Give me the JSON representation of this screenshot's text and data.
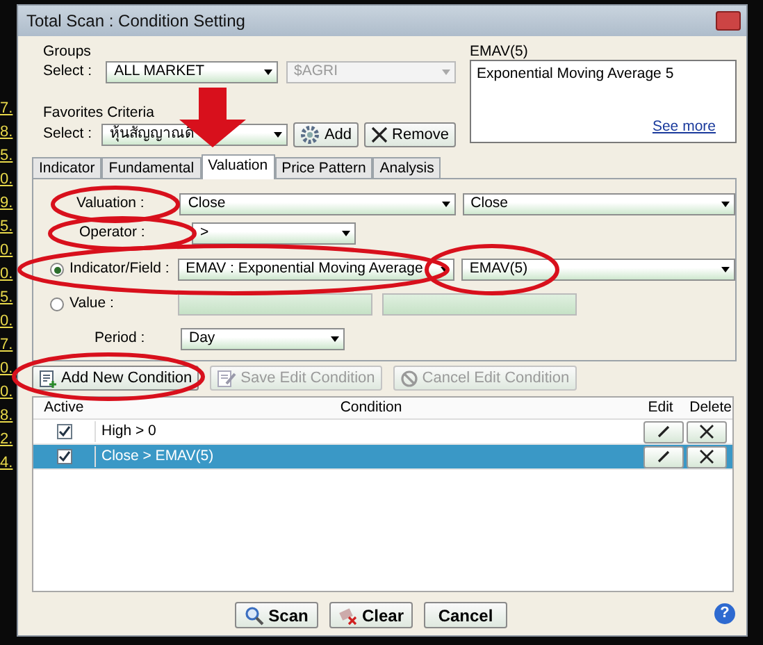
{
  "window": {
    "title": "Total Scan : Condition Setting"
  },
  "background_text": [
    "7.",
    "8.",
    "5.",
    "0.",
    "9.",
    "5.",
    "0.",
    "0.",
    "5.",
    "0.",
    "7.",
    "0.",
    "0.",
    "8.",
    "2.",
    "4."
  ],
  "groups": {
    "heading": "Groups",
    "select_label": "Select :",
    "market": "ALL MARKET",
    "group": "$AGRI",
    "group_disabled": true
  },
  "favorites": {
    "heading": "Favorites Criteria",
    "select_label": "Select :",
    "value": "หุ้นสัญญาณดี",
    "add_button": "Add",
    "remove_button": "Remove"
  },
  "description": {
    "title": "EMAV(5)",
    "text": "Exponential Moving Average 5",
    "link": "See more"
  },
  "tabs": [
    {
      "label": "Indicator",
      "selected": false
    },
    {
      "label": "Fundamental",
      "selected": false
    },
    {
      "label": "Valuation",
      "selected": true
    },
    {
      "label": "Price Pattern",
      "selected": false
    },
    {
      "label": "Analysis",
      "selected": false
    }
  ],
  "form": {
    "valuation_label": "Valuation :",
    "valuation": [
      "Close",
      "Close"
    ],
    "operator_label": "Operator :",
    "operator": ">",
    "sources": [
      {
        "label": "Indicator/Field :",
        "selected": true,
        "kind": "combo",
        "values": [
          "EMAV : Exponential Moving Average",
          "EMAV(5)"
        ]
      },
      {
        "label": "Value :",
        "selected": false,
        "kind": "text"
      }
    ],
    "period_label": "Period :",
    "period": "Day"
  },
  "condition_buttons": [
    {
      "label": "Add New Condition",
      "disabled": false,
      "kind": "add"
    },
    {
      "label": "Save Edit Condition",
      "disabled": true,
      "kind": "save"
    },
    {
      "label": "Cancel Edit Condition",
      "disabled": true,
      "kind": "cancel"
    }
  ],
  "conditions": {
    "columns": [
      "Active",
      "Condition",
      "Edit",
      "Delete"
    ],
    "rows": [
      {
        "active": true,
        "condition": "High > 0",
        "selected": false
      },
      {
        "active": true,
        "condition": "Close > EMAV(5)",
        "selected": true
      }
    ]
  },
  "buttons": [
    {
      "label": "Scan",
      "kind": "scan"
    },
    {
      "label": "Clear",
      "kind": "clear"
    },
    {
      "label": "Cancel",
      "kind": "cancel"
    }
  ],
  "help": "?"
}
